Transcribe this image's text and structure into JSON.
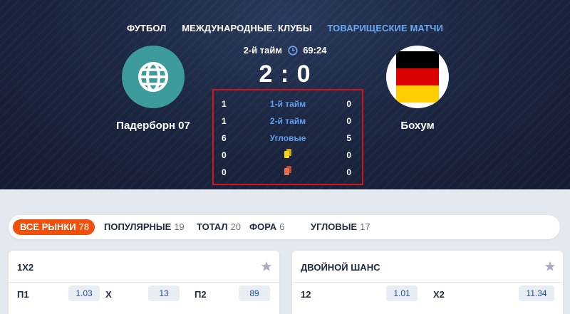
{
  "breadcrumbs": [
    "ФУТБОЛ",
    "МЕЖДУНАРОДНЫЕ. КЛУБЫ",
    "ТОВАРИЩЕСКИЕ МАТЧИ"
  ],
  "match": {
    "period": "2-й тайм",
    "clock_icon": "clock-icon",
    "time": "69:24",
    "score": "2 : 0",
    "home": {
      "name": "Падерборн 07",
      "logo_icon": "globe-icon"
    },
    "away": {
      "name": "Бохум",
      "logo_icon": "germany-flag-icon"
    }
  },
  "stats": [
    {
      "home": "1",
      "label": "1-й тайм",
      "away": "0"
    },
    {
      "home": "1",
      "label": "2-й тайм",
      "away": "0"
    },
    {
      "home": "6",
      "label": "Угловые",
      "away": "5"
    },
    {
      "home": "0",
      "icon": "yellow-card-icon",
      "away": "0"
    },
    {
      "home": "0",
      "icon": "red-card-icon",
      "away": "0"
    }
  ],
  "tabs": [
    {
      "label": "ВСЕ РЫНКИ",
      "count": "78",
      "active": true
    },
    {
      "label": "ПОПУЛЯРНЫЕ",
      "count": "19"
    },
    {
      "label": "ТОТАЛ",
      "count": "20"
    },
    {
      "label": "ФОРА",
      "count": "6"
    },
    {
      "label": "УГЛОВЫЕ",
      "count": "17"
    }
  ],
  "markets": [
    {
      "title": "1Х2",
      "outcomes": [
        {
          "label": "П1",
          "odd": "1.03"
        },
        {
          "label": "Х",
          "odd": "13"
        },
        {
          "label": "П2",
          "odd": "89"
        }
      ]
    },
    {
      "title": "ДВОЙНОЙ ШАНС",
      "outcomes": [
        {
          "label": "12",
          "odd": "1.01"
        },
        {
          "label": "Х2",
          "odd": "11.34"
        }
      ]
    }
  ],
  "colors": {
    "accent": "#f14f0b",
    "link": "#5e9ff0",
    "highlight_border": "#d8141b",
    "yellow_card": "#f2d21b",
    "red_card": "#e8704e"
  }
}
